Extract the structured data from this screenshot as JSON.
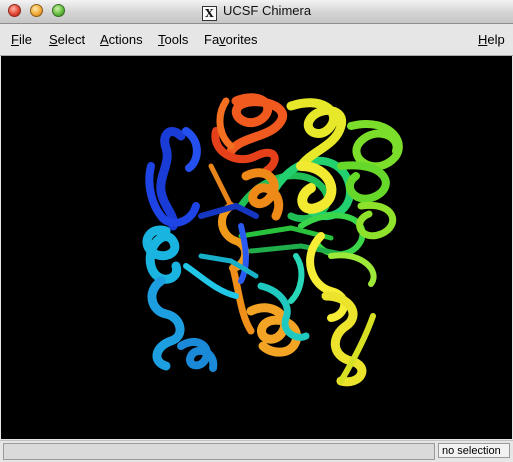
{
  "window": {
    "title": "UCSF Chimera",
    "x_icon_glyph": "X"
  },
  "menubar": {
    "file": {
      "underline": "F",
      "rest": "ile"
    },
    "select": {
      "underline": "S",
      "rest": "elect"
    },
    "actions": {
      "underline": "A",
      "rest": "ctions"
    },
    "tools": {
      "underline": "T",
      "rest": "ools"
    },
    "favorites": {
      "pre": "Fa",
      "underline": "v",
      "rest": "orites"
    },
    "help": {
      "underline": "H",
      "rest": "elp"
    }
  },
  "viewer": {
    "background": "#000000",
    "model": "protein ribbon (rainbow N→C)",
    "ribbon_colors": [
      "#1a3cd6",
      "#1ab4e0",
      "#1fc9c0",
      "#22d070",
      "#66d82a",
      "#c8ea2a",
      "#f2ea30",
      "#f0a020",
      "#ee8a18",
      "#f05a1e"
    ]
  },
  "statusbar": {
    "message": "",
    "selection_text": "no selection"
  }
}
